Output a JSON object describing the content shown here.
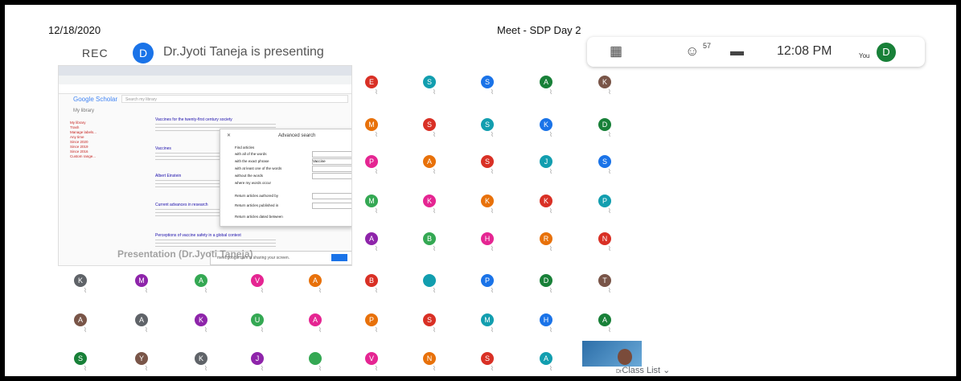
{
  "header": {
    "date": "12/18/2020",
    "meeting_title": "Meet - SDP Day 2",
    "rec_label": "REC",
    "presenter_initial": "D",
    "presenting_text": "Dr.Jyoti Taneja is presenting"
  },
  "topbar": {
    "participant_count": "57",
    "time": "12:08 PM",
    "you_label": "You",
    "self_initial": "D"
  },
  "presentation": {
    "label": "Presentation (Dr.Jyoti Taneja)",
    "site_name": "Google Scholar",
    "search_placeholder": "Search my library",
    "library_label": "My library",
    "side_links": [
      "My library",
      "Trash",
      "Manage labels...",
      "Any time",
      "Since 2020",
      "Since 2019",
      "Since 2016",
      "Custom range..."
    ],
    "articles": [
      "Vaccines for the twenty-first century society",
      "Vaccines",
      "Albert Einstein",
      "Current advances in research",
      "Perceptions of vaccine safety in a global context"
    ],
    "advanced_search_title": "Advanced search",
    "advanced_rows": [
      "Find articles",
      "with all of the words",
      "with the exact phrase",
      "with at least one of the words",
      "without the words",
      "where my words occur",
      "Return articles authored by",
      "Return articles published in",
      "Return articles dated between"
    ],
    "exact_phrase_value": "Vaccine",
    "share_text": "meet.google.com is sharing your screen."
  },
  "participants": [
    [
      "E",
      "S",
      "S",
      "A",
      "K"
    ],
    [
      "M",
      "S",
      "S",
      "K",
      "D"
    ],
    [
      "P",
      "A",
      "S",
      "J",
      "S"
    ],
    [
      "M",
      "K",
      "K",
      "K",
      "P"
    ],
    [
      "A",
      "B",
      "H",
      "R",
      "N"
    ],
    [
      "K",
      "M",
      "A",
      "V",
      "A",
      "B",
      "",
      "P",
      "D",
      "T"
    ],
    [
      "A",
      "A",
      "K",
      "U",
      "A",
      "P",
      "S",
      "M",
      "H",
      "A"
    ],
    [
      "S",
      "Y",
      "K",
      "J",
      "",
      "V",
      "N",
      "S",
      "A"
    ]
  ],
  "colors": {
    "red": "#d93025",
    "green": "#188038",
    "purple": "#8e24aa",
    "orange": "#e8710a",
    "blue": "#1a73e8",
    "grey": "#5f6368",
    "pink": "#e52592",
    "teal": "#129eaf",
    "brown": "#795548",
    "lightgreen": "#34a853"
  },
  "bottom_panel": {
    "prefix": "Dr",
    "class_list_label": "Class List"
  }
}
